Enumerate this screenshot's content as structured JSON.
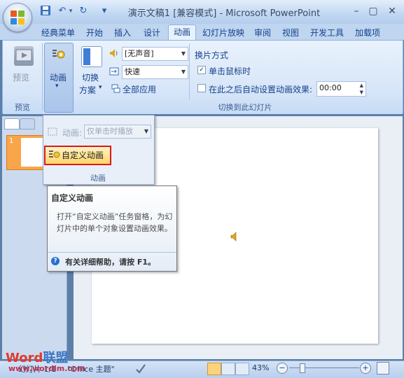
{
  "window": {
    "title": "演示文稿1 [兼容模式] - Microsoft PowerPoint",
    "minimize": "–",
    "restore": "▢",
    "close": "✕"
  },
  "qat": {
    "save": "save-icon",
    "undo": "undo-icon",
    "redo": "redo-icon",
    "more": "▾",
    "undo_glyph": "↶",
    "redo_glyph": "↻",
    "undo_arrow": "▾"
  },
  "tabs": [
    "经典菜单",
    "开始",
    "插入",
    "设计",
    "动画",
    "幻灯片放映",
    "审阅",
    "视图",
    "开发工具",
    "加载项"
  ],
  "ribbon": {
    "preview": {
      "label": "预览",
      "group": "预览"
    },
    "animation": {
      "label": "动画",
      "arrow": "▾"
    },
    "switch_scheme": {
      "label_top": "切换",
      "label_bottom": "方案",
      "arrow": "▾"
    },
    "sound": {
      "value": "[无声音]"
    },
    "speed": {
      "value": "快速"
    },
    "apply_all": "全部应用",
    "switch_mode_title": "换片方式",
    "on_click": {
      "label": "单击鼠标时",
      "checked": "✓"
    },
    "auto_after": {
      "label": "在此之后自动设置动画效果:",
      "value": "00:00"
    },
    "group_transition": "切换到此幻灯片"
  },
  "dropdown": {
    "anim_label": "动画:",
    "anim_value": "仅单击时播放",
    "custom_anim": "自定义动画",
    "group": "动画"
  },
  "tooltip": {
    "title": "自定义动画",
    "body": "打开“自定义动画”任务窗格，为幻灯片中的单个对象设置动画效果。",
    "help": "有关详细帮助，请按 F1。",
    "help_icon": "?"
  },
  "thumb_number": "1",
  "status": {
    "slide_info": "幻灯片 1/1",
    "theme": "\"Office 主题\"",
    "zoom": "43%",
    "minus": "−",
    "plus": "+"
  },
  "watermark": {
    "word": "Word",
    "rest": "联盟",
    "url": "www.wordlm.com"
  }
}
